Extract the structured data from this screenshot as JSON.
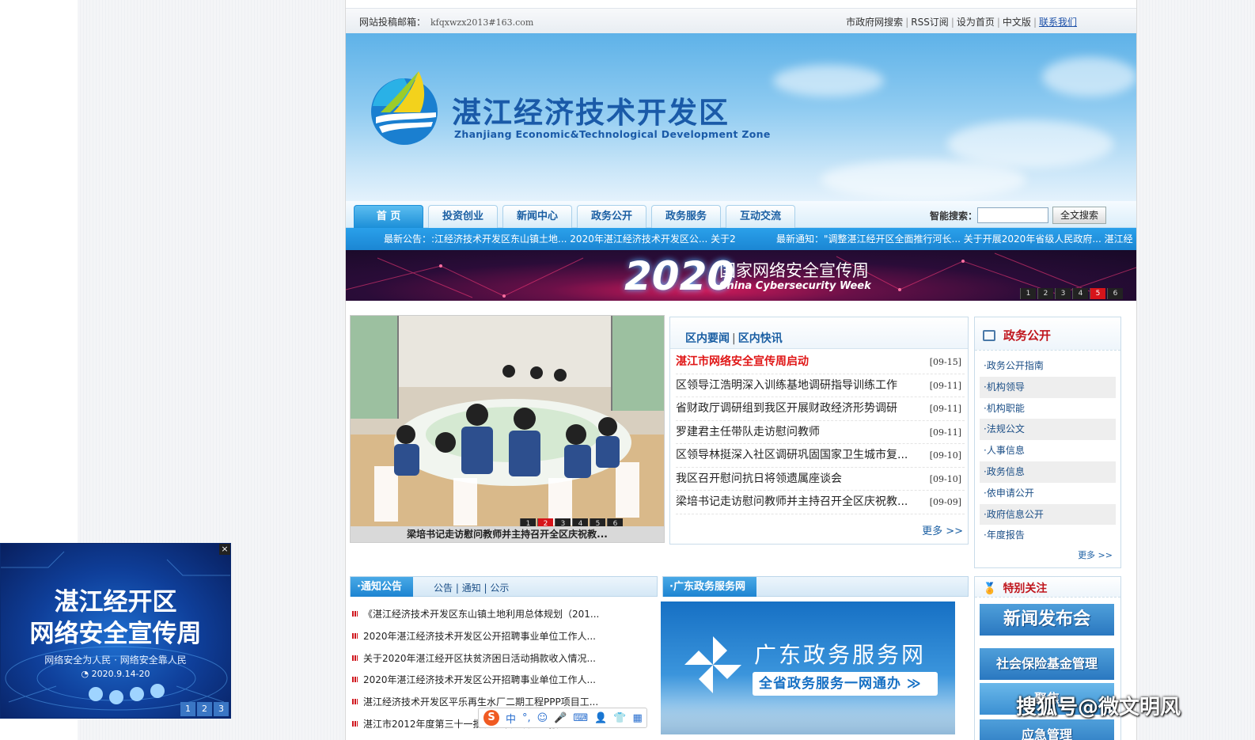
{
  "topbar": {
    "mail_label": "网站投稿邮箱：",
    "mail_value": "kfqxwzx2013#163.com",
    "links": [
      "市政府网搜索",
      "RSS订阅",
      "设为首页",
      "中文版"
    ],
    "contact": "联系我们"
  },
  "banner": {
    "title_cn": "湛江经济技术开发区",
    "title_en": "Zhanjiang Economic&Technological Development Zone"
  },
  "nav": {
    "tabs": [
      "首 页",
      "投资创业",
      "新闻中心",
      "政务公开",
      "政务服务",
      "互动交流"
    ],
    "search_label": "智能搜索：",
    "search_button": "全文搜索"
  },
  "notice_bar": {
    "latest_announcement": "最新公告：:江经济技术开发区东山镇土地...   2020年湛江经济技术开发区公...   关于2",
    "latest_notice": "最新通知：\"调整湛江经开区全面推行河长...   关于开展2020年省级人民政府...   湛江经"
  },
  "hero": {
    "year": "2020",
    "title_cn": "国家网络安全宣传周",
    "title_en": "China Cybersecurity Week",
    "pages": [
      "1",
      "2",
      "3",
      "4",
      "5",
      "6"
    ],
    "active_page": "5"
  },
  "photo": {
    "caption": "梁培书记走访慰问教师并主持召开全区庆祝教...",
    "pages": [
      "1",
      "2",
      "3",
      "4",
      "5",
      "6"
    ],
    "active_page": "2"
  },
  "news": {
    "tab1": "区内要闻",
    "tab2": "区内快讯",
    "items": [
      {
        "title": "湛江市网络安全宣传周启动",
        "date": "[09-15]"
      },
      {
        "title": "区领导江浩明深入训练基地调研指导训练工作",
        "date": "[09-11]"
      },
      {
        "title": "省财政厅调研组到我区开展财政经济形势调研",
        "date": "[09-11]"
      },
      {
        "title": "罗建君主任带队走访慰问教师",
        "date": "[09-11]"
      },
      {
        "title": "区领导林挺深入社区调研巩固国家卫生城市复...",
        "date": "[09-10]"
      },
      {
        "title": "我区召开慰问抗日将领遗属座谈会",
        "date": "[09-10]"
      },
      {
        "title": "梁培书记走访慰问教师并主持召开全区庆祝教...",
        "date": "[09-09]"
      }
    ],
    "more": "更多 >>"
  },
  "gov": {
    "title": "政务公开",
    "items": [
      "·政务公开指南",
      "·机构领导",
      "·机构职能",
      "·法规公文",
      "·人事信息",
      "·政务信息",
      "·依申请公开",
      "·政府信息公开",
      "·年度报告"
    ],
    "more": "更多 >>"
  },
  "notices": {
    "title": "·通知公告",
    "subs": [
      "公告",
      "通知",
      "公示"
    ],
    "items": [
      "《湛江经济技术开发区东山镇土地利用总体规划（201...",
      "2020年湛江经济技术开发区公开招聘事业单位工作人...",
      "关于2020年湛江经开区扶贫济困日活动捐款收入情况...",
      "2020年湛江经济技术开发区公开招聘事业单位工作人...",
      "湛江经济技术开发区平乐再生水厂二期工程PPP项目工...",
      "湛江市2012年度第三十一批次城市建设用地报批..."
    ]
  },
  "gd_service": {
    "title": "·广东政务服务网",
    "banner_title": "广东政务服务网",
    "banner_slogan": "全省政务服务一网通办"
  },
  "special": {
    "title": "特别关注",
    "tiles": [
      "新闻发布会",
      "社会保险基金管理",
      "聚焦",
      "应急管理"
    ]
  },
  "float_ad": {
    "line1": "湛江经开区",
    "line2": "网络安全宣传周",
    "slogan": "网络安全为人民 · 网络安全靠人民",
    "date": "2020.9.14-20",
    "close": "×",
    "pages": [
      "1",
      "2",
      "3"
    ]
  },
  "ime": {
    "logo": "S",
    "mode": "中"
  },
  "watermark": "搜狐号@微文明风",
  "colors": {
    "brand_blue": "#1b86d3",
    "heading_red": "#c0161d",
    "hot_red": "#e01616",
    "link_blue": "#1b4e86"
  }
}
